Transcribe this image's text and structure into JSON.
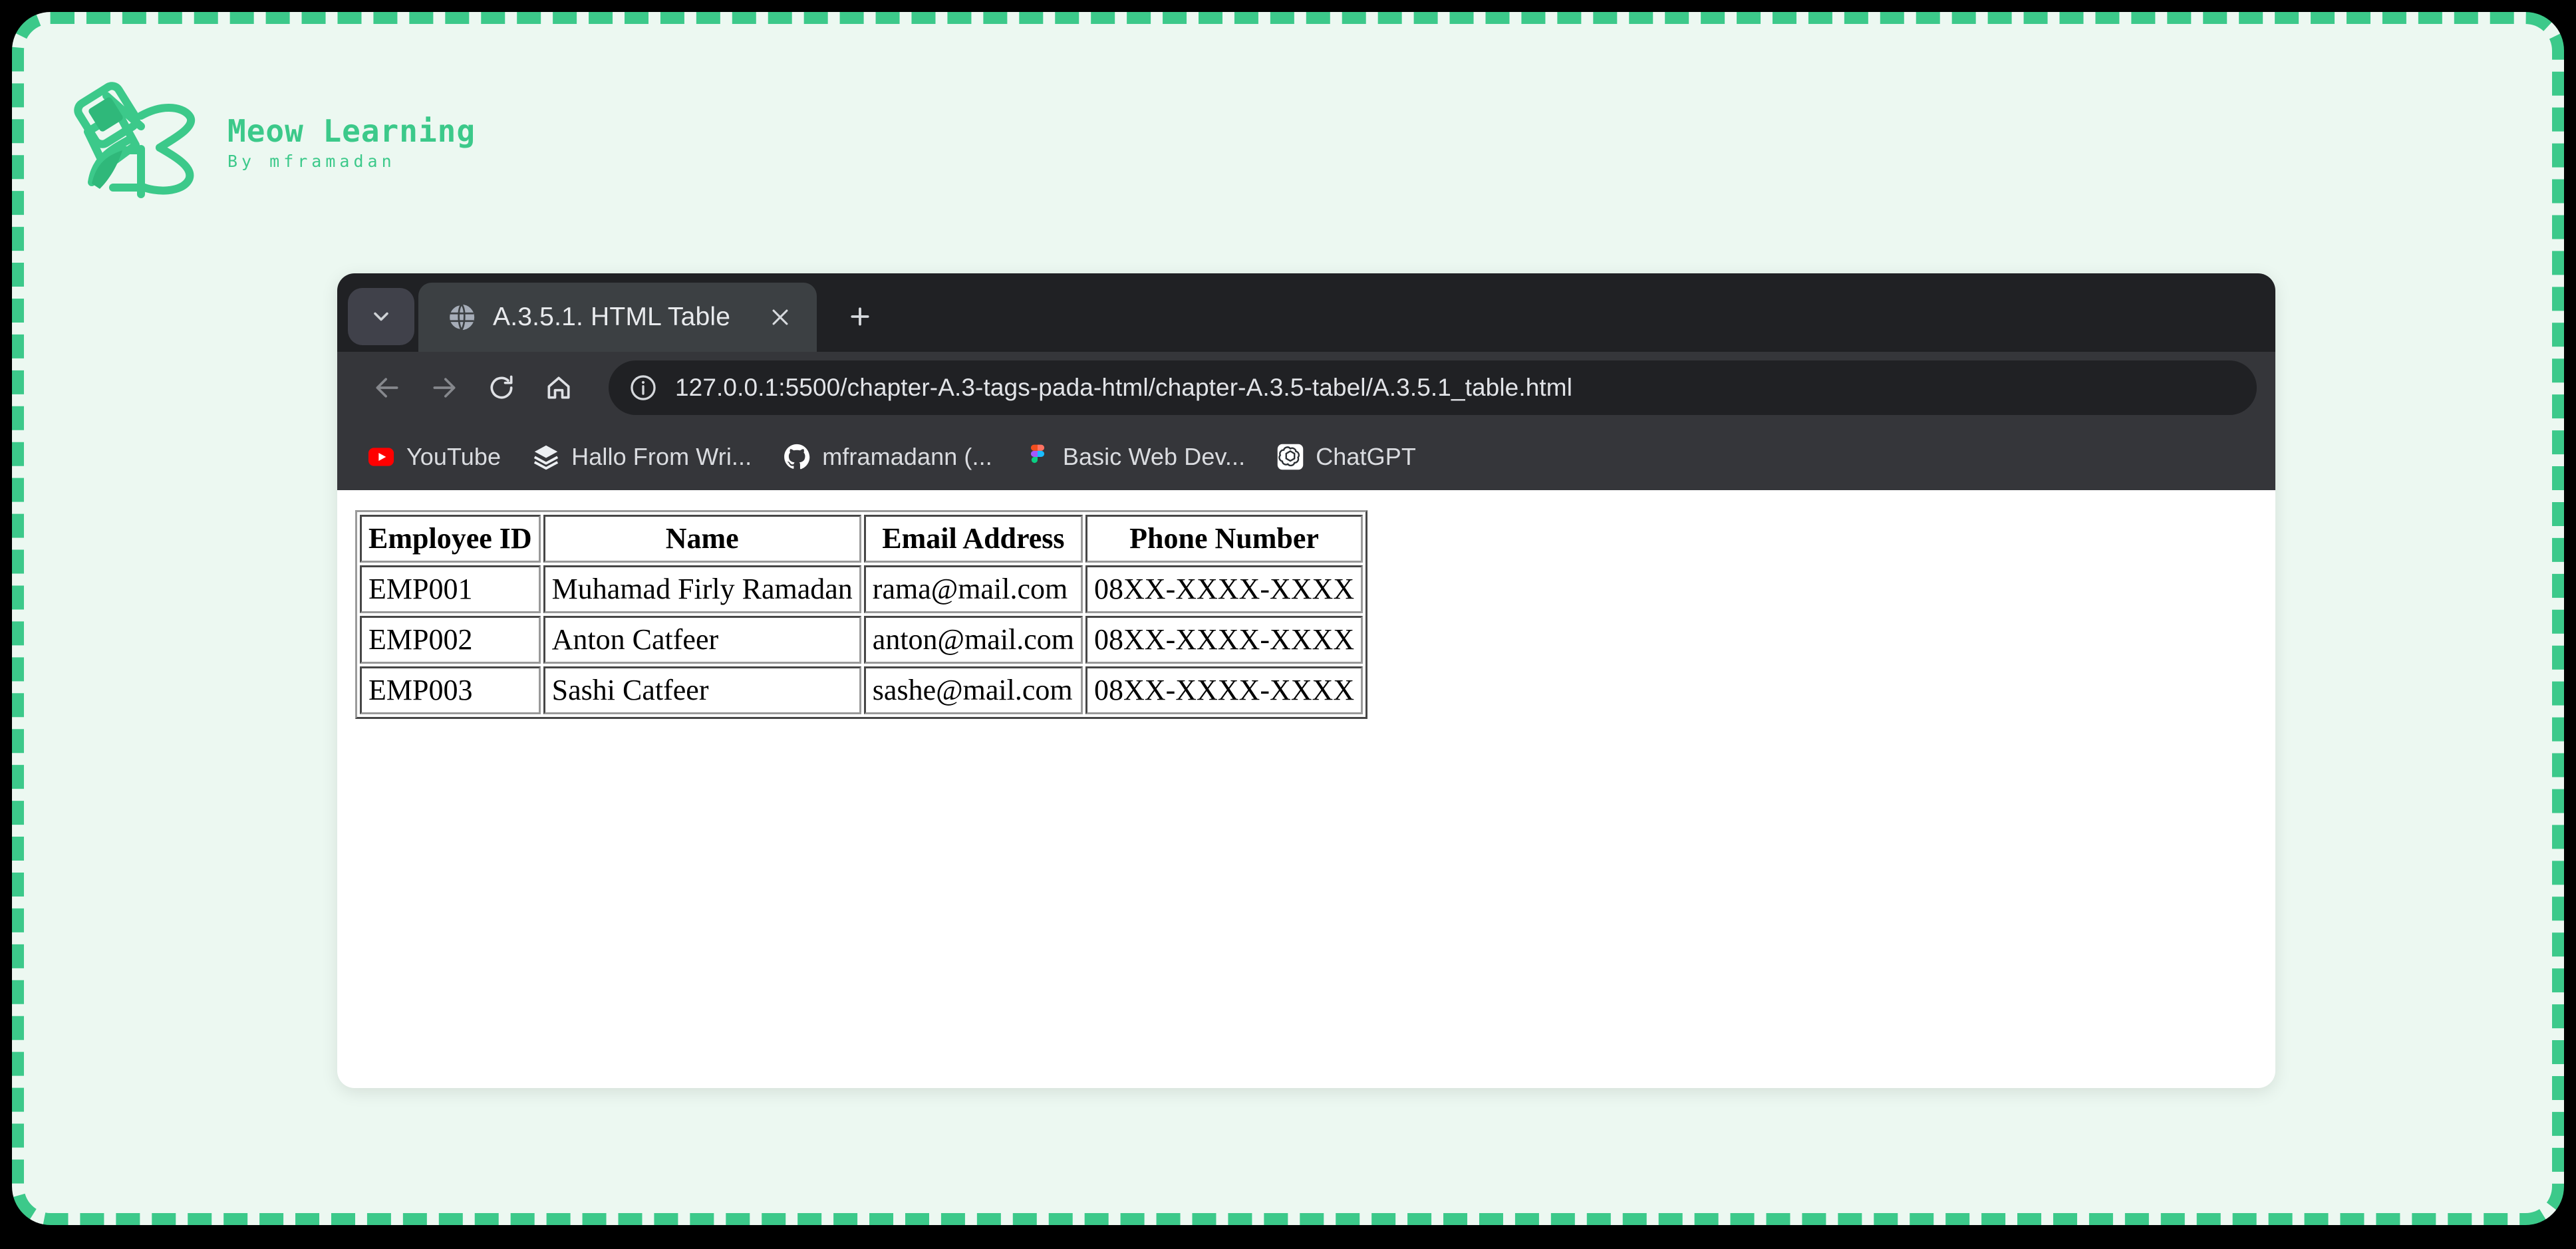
{
  "brand": {
    "title": "Meow Learning",
    "subtitle": "By mframadan",
    "logo_icon": "meow-learning-logo",
    "accent_color": "#3cc98a",
    "page_background": "#ecf8f1",
    "frame_color": "#000000"
  },
  "browser": {
    "tab_search_icon": "chevron-down-icon",
    "tabs": [
      {
        "title": "A.3.5.1. HTML Table",
        "favicon": "globe-icon",
        "close_icon": "close-icon",
        "active": true
      }
    ],
    "new_tab_icon": "plus-icon",
    "toolbar": {
      "back_icon": "arrow-left-icon",
      "forward_icon": "arrow-right-icon",
      "reload_icon": "reload-icon",
      "home_icon": "home-icon",
      "site_info_icon": "info-circle-icon",
      "url": "127.0.0.1:5500/chapter-A.3-tags-pada-html/chapter-A.3.5-tabel/A.3.5.1_table.html"
    },
    "bookmarks": [
      {
        "label": "YouTube",
        "icon": "youtube-icon"
      },
      {
        "label": "Hallo From Wri...",
        "icon": "layers-icon"
      },
      {
        "label": "mframadann (...",
        "icon": "github-icon"
      },
      {
        "label": "Basic Web Dev...",
        "icon": "figma-icon"
      },
      {
        "label": "ChatGPT",
        "icon": "openai-icon"
      }
    ]
  },
  "page": {
    "table": {
      "headers": [
        "Employee ID",
        "Name",
        "Email Address",
        "Phone Number"
      ],
      "rows": [
        [
          "EMP001",
          "Muhamad Firly Ramadan",
          "rama@mail.com",
          "08XX-XXXX-XXXX"
        ],
        [
          "EMP002",
          "Anton Catfeer",
          "anton@mail.com",
          "08XX-XXXX-XXXX"
        ],
        [
          "EMP003",
          "Sashi Catfeer",
          "sashe@mail.com",
          "08XX-XXXX-XXXX"
        ]
      ]
    }
  }
}
